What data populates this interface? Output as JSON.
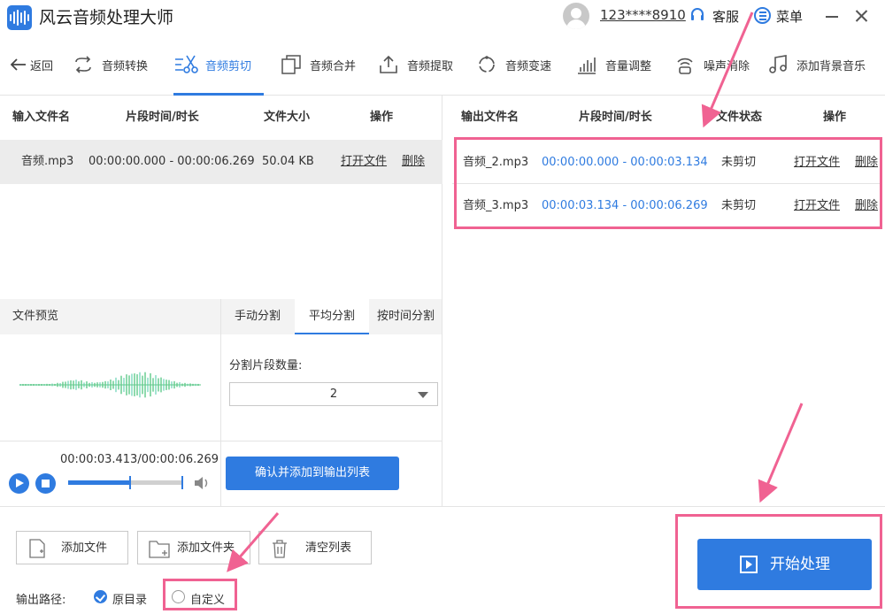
{
  "app": {
    "title": "风云音频处理大师",
    "user_phone": "123****8910",
    "service_label": "客服",
    "menu_label": "菜单"
  },
  "toolbar": {
    "back_label": "返回",
    "items": [
      {
        "label": "音频转换",
        "icon": "convert-icon"
      },
      {
        "label": "音频剪切",
        "icon": "scissors-icon",
        "active": true
      },
      {
        "label": "音频合并",
        "icon": "merge-icon"
      },
      {
        "label": "音频提取",
        "icon": "extract-icon"
      },
      {
        "label": "音频变速",
        "icon": "speed-icon"
      },
      {
        "label": "音量调整",
        "icon": "volume-bars-icon"
      },
      {
        "label": "噪声消除",
        "icon": "noise-icon"
      },
      {
        "label": "添加背景音乐",
        "icon": "music-note-icon"
      }
    ]
  },
  "input_table": {
    "headers": [
      "输入文件名",
      "片段时间/时长",
      "文件大小",
      "操作"
    ],
    "rows": [
      {
        "name": "音频.mp3",
        "range": "00:00:00.000 - 00:00:06.269",
        "size": "50.04 KB",
        "open": "打开文件",
        "delete": "删除"
      }
    ]
  },
  "preview": {
    "label": "文件预览",
    "time": "00:00:03.413/00:00:06.269",
    "progress": 0.545
  },
  "split_tabs": {
    "tabs": [
      "手动分割",
      "平均分割",
      "按时间分割"
    ],
    "active_index": 1,
    "count_label": "分割片段数量:",
    "count_value": "2",
    "confirm_label": "确认并添加到输出列表"
  },
  "output_table": {
    "headers": [
      "输出文件名",
      "片段时间/时长",
      "文件状态",
      "操作"
    ],
    "rows": [
      {
        "name": "音频_2.mp3",
        "range": "00:00:00.000 - 00:00:03.134",
        "status": "未剪切",
        "open": "打开文件",
        "delete": "删除"
      },
      {
        "name": "音频_3.mp3",
        "range": "00:00:03.134 - 00:00:06.269",
        "status": "未剪切",
        "open": "打开文件",
        "delete": "删除"
      }
    ]
  },
  "bottom": {
    "add_file": "添加文件",
    "add_folder": "添加文件夹",
    "clear_list": "清空列表",
    "output_path_label": "输出路径:",
    "option_original": "原目录",
    "option_custom": "自定义",
    "start_label": "开始处理"
  },
  "colors": {
    "accent": "#2f7be0",
    "annotation": "#f06292",
    "wave_green": "#5fc98a"
  }
}
